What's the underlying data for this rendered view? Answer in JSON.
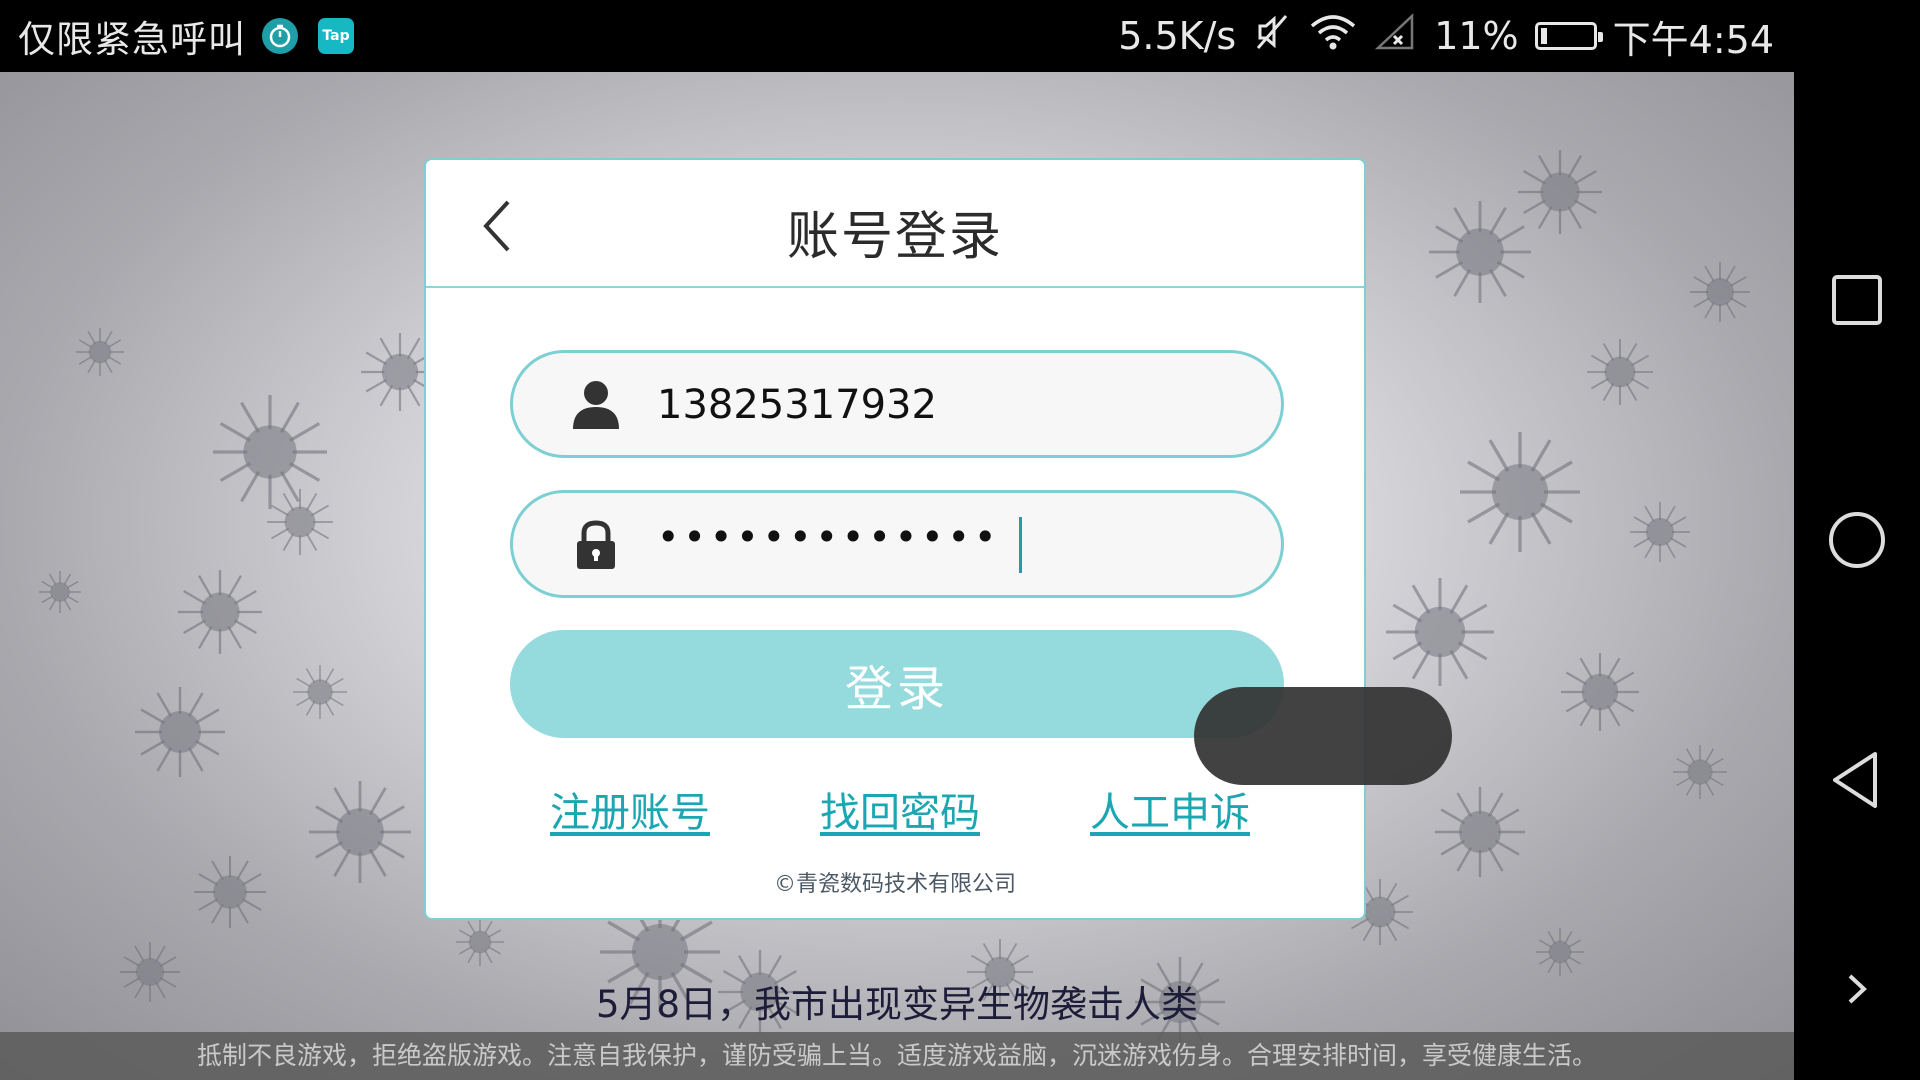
{
  "status_bar": {
    "carrier": "仅限紧急呼叫",
    "tap_icon_text": "Tap",
    "net_speed": "5.5K/s",
    "battery_percent": "11%",
    "battery_level": 0.11,
    "time": "下午4:54",
    "icons": [
      "stopwatch-icon",
      "tap-icon",
      "mute-icon",
      "wifi-icon",
      "no-signal-icon",
      "battery-icon"
    ]
  },
  "dialog": {
    "title": "账号登录",
    "username": {
      "value": "13825317932",
      "icon": "user-icon"
    },
    "password": {
      "value": "•••••••••••••",
      "icon": "lock-icon"
    },
    "login_label": "登录",
    "links": {
      "register": "注册账号",
      "recover": "找回密码",
      "appeal": "人工申诉"
    },
    "copyright": "©青瓷数码技术有限公司"
  },
  "scene": {
    "caption": "5月8日，我市出现变异生物袭击人类",
    "notice": "抵制不良游戏，拒绝盗版游戏。注意自我保护，谨防受骗上当。适度游戏益脑，沉迷游戏伤身。合理安排时间，享受健康生活。"
  },
  "colors": {
    "accent": "#7ccfd3",
    "button": "#95dadd",
    "link": "#1ba6b1"
  }
}
